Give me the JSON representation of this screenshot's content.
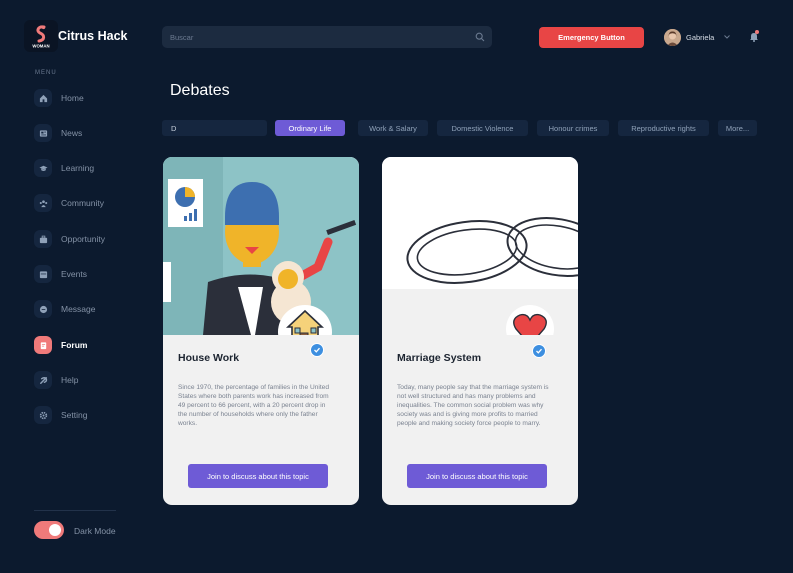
{
  "app": {
    "name": "Citrus Hack",
    "logo_text": "WOMAN"
  },
  "sidebar": {
    "menu_label": "MENU",
    "items": [
      {
        "label": "Home",
        "icon": "home-icon"
      },
      {
        "label": "News",
        "icon": "news-icon"
      },
      {
        "label": "Learning",
        "icon": "graduation-cap-icon"
      },
      {
        "label": "Community",
        "icon": "community-icon"
      },
      {
        "label": "Opportunity",
        "icon": "briefcase-icon"
      },
      {
        "label": "Events",
        "icon": "calendar-icon"
      },
      {
        "label": "Message",
        "icon": "chat-icon"
      },
      {
        "label": "Forum",
        "icon": "forum-icon",
        "active": true
      },
      {
        "label": "Help",
        "icon": "help-icon"
      },
      {
        "label": "Setting",
        "icon": "gear-icon"
      }
    ],
    "dark_mode_label": "Dark Mode",
    "dark_mode_on": true
  },
  "header": {
    "search_placeholder": "Buscar",
    "emergency_label": "Emergency Button",
    "user_name": "Gabriela"
  },
  "main": {
    "title": "Debates",
    "filter_value": "D",
    "chips": [
      {
        "label": "Ordinary Life",
        "active": true
      },
      {
        "label": "Work & Salary"
      },
      {
        "label": "Domestic Violence"
      },
      {
        "label": "Honour crimes"
      },
      {
        "label": "Reproductive rights"
      },
      {
        "label": "More..."
      }
    ],
    "cards": [
      {
        "title": "House Work",
        "description": "Since 1970, the percentage of families in the United States where both parents work has increased from 49 percent to 66 percent, with a 20 percent drop in the number of households where only the father works.",
        "button": "Join to discuss about this topic",
        "badge_icon": "house-icon"
      },
      {
        "title": "Marriage System",
        "description": "Today, many people say that the marriage system is not well structured and has many problems and inequalities. The common social problem was why society was and is giving more profits to married people and making society force people to marry.",
        "button": "Join to discuss about this topic",
        "badge_icon": "heart-icon"
      }
    ]
  },
  "colors": {
    "background": "#0c1a2e",
    "accent": "#6e5bd6",
    "emergency": "#e84545",
    "active_nav": "#f07a7a"
  }
}
